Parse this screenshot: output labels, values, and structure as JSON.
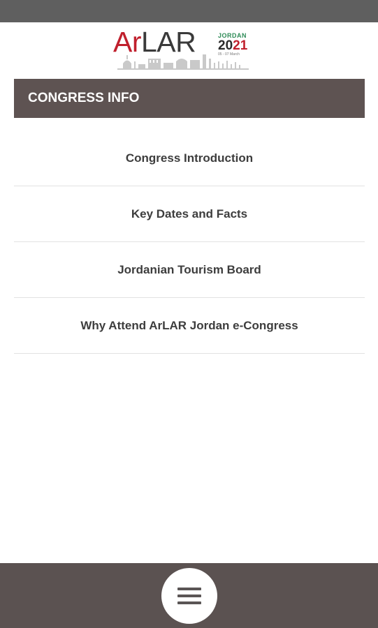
{
  "logo": {
    "brand_part1": "Ar",
    "brand_part2": "LAR",
    "country": "JORDAN",
    "year_part1": "20",
    "year_part2": "21",
    "dates": "05 - 07 March",
    "colors": {
      "red": "#c0202d",
      "dark": "#3a3a3a",
      "green": "#2e8b57"
    }
  },
  "section": {
    "title": "CONGRESS INFO",
    "background": "#5e5352"
  },
  "menu": {
    "items": [
      {
        "label": "Congress Introduction"
      },
      {
        "label": "Key Dates and Facts"
      },
      {
        "label": "Jordanian Tourism Board"
      },
      {
        "label": "Why Attend ArLAR Jordan e-Congress"
      }
    ]
  },
  "bottom_bar": {
    "icon": "hamburger-icon",
    "background": "#5b5251"
  }
}
